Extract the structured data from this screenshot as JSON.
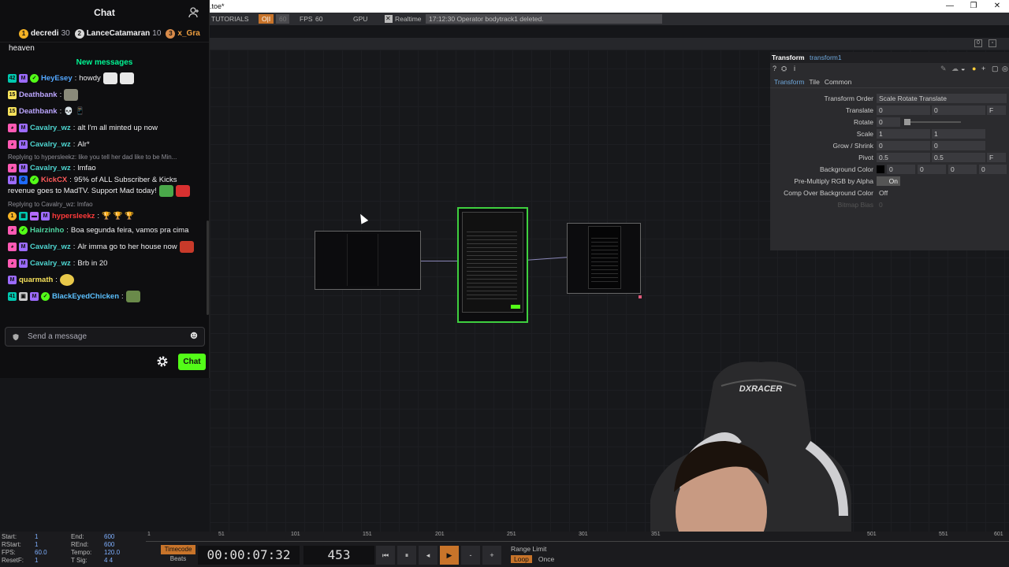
{
  "chat": {
    "title": "Chat",
    "leaderboard": [
      {
        "rank": "1",
        "name": "decredi",
        "score": "30",
        "color": "#f5b325"
      },
      {
        "rank": "2",
        "name": "LanceCatamaran",
        "score": "10",
        "color": "#d9d9d9"
      },
      {
        "rank": "3",
        "name": "x_Gra",
        "score": "",
        "color": "#d88b4a"
      }
    ],
    "pinned_line": "heaven",
    "new_messages_label": "New messages",
    "messages": [
      {
        "user": "HeyEsey",
        "user_color": "#53a7ff",
        "text": "howdy"
      },
      {
        "user": "Deathbank",
        "user_color": "#bca6ff",
        "text": ""
      },
      {
        "user": "Deathbank",
        "user_color": "#bca6ff",
        "text": "💀 📱"
      },
      {
        "user": "Cavalry_wz",
        "user_color": "#4ed5d0",
        "text": "alt I'm all minted up now"
      },
      {
        "user": "Cavalry_wz",
        "user_color": "#4ed5d0",
        "text": "Alr*"
      },
      {
        "reply": "Replying to hypersleekz: like you tell her dad like to be Min...",
        "user": "Cavalry_wz",
        "user_color": "#4ed5d0",
        "text": "lmfao"
      },
      {
        "user": "KickCX",
        "user_color": "#ff5a5a",
        "text": "95% of ALL Subscriber & Kicks",
        "text2": "revenue goes to MadTV. Support Mad today!"
      },
      {
        "reply": "Replying to Cavalry_wz: lmfao",
        "user": "hypersleekz",
        "user_color": "#ff3a3a",
        "text": "🏆 🏆 🏆"
      },
      {
        "user": "Hairzinho",
        "user_color": "#4ed5a0",
        "text": "Boa segunda feira, vamos pra cima"
      },
      {
        "user": "Cavalry_wz",
        "user_color": "#4ed5d0",
        "text": "Alr imma go to her house now"
      },
      {
        "user": "Cavalry_wz",
        "user_color": "#4ed5d0",
        "text": "Brb in 20"
      },
      {
        "user": "quarmath",
        "user_color": "#f7e25b",
        "text": ""
      },
      {
        "user": "BlackEyedChicken",
        "user_color": "#5bc0ff",
        "text": ""
      }
    ],
    "input_placeholder": "Send a message",
    "send_label": "Chat"
  },
  "window": {
    "title": ".toe*",
    "status": "17:12:30 Operator bodytrack1 deleted.",
    "tutorials": "TUTORIALS",
    "fps_label": "FPS",
    "fps_value": "60",
    "gpu_label": "GPU",
    "realtime_label": "Realtime"
  },
  "params": {
    "type": "Transform",
    "name": "transform1",
    "tabs": [
      "Transform",
      "Tile",
      "Common"
    ],
    "rows": [
      {
        "label": "Transform Order",
        "v1": "Scale Rotate Translate"
      },
      {
        "label": "Translate",
        "v1": "0",
        "v2": "0",
        "unit": "F"
      },
      {
        "label": "Rotate",
        "v1": "0"
      },
      {
        "label": "Scale",
        "v1": "1",
        "v2": "1"
      },
      {
        "label": "Grow / Shrink",
        "v1": "0",
        "v2": "0"
      },
      {
        "label": "Pivot",
        "v1": "0.5",
        "v2": "0.5",
        "unit": "F"
      },
      {
        "label": "Background Color",
        "v1": "0",
        "v2": "0",
        "v3": "0",
        "v4": "0"
      },
      {
        "label": "Pre-Multiply RGB by Alpha",
        "v1": "On"
      },
      {
        "label": "Comp Over Background Color",
        "v1": "Off"
      },
      {
        "label": "Bitmap Bias",
        "v1": "0"
      }
    ]
  },
  "timeline": {
    "start_label": "Start:",
    "start": "1",
    "end_label": "End:",
    "end": "600",
    "rstart_label": "RStart:",
    "rstart": "1",
    "rend_label": "REnd:",
    "rend": "600",
    "fps_label": "FPS:",
    "fps": "60.0",
    "tempo_label": "Tempo:",
    "tempo": "120.0",
    "resetf_label": "ResetF:",
    "resetf": "1",
    "tsig_label": "T Sig:",
    "tsig": "4    4",
    "ruler": [
      "1",
      "51",
      "101",
      "151",
      "201",
      "251",
      "301",
      "351",
      "501",
      "551",
      "601"
    ],
    "timecode_label": "Timecode",
    "beats_label": "Beats",
    "timecode": "00:00:07:32",
    "frame": "453",
    "range_limit": "Range Limit",
    "loop": "Loop",
    "once": "Once"
  },
  "webcam": {
    "brand": "DXRACER"
  }
}
